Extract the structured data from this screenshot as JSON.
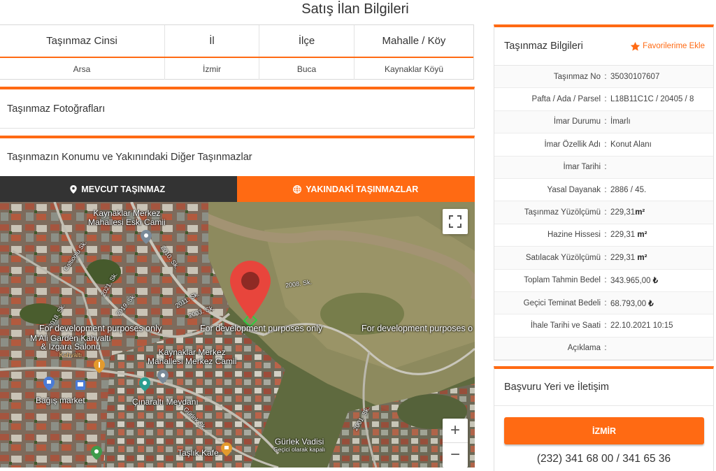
{
  "page_title": "Satış İlan Bilgileri",
  "summary": {
    "headers": [
      "Taşınmaz Cinsi",
      "İl",
      "İlçe",
      "Mahalle / Köy"
    ],
    "values": [
      "Arsa",
      "İzmir",
      "Buca",
      "Kaynaklar Köyü"
    ]
  },
  "photos_panel": {
    "title": "Taşınmaz Fotoğrafları"
  },
  "location_panel": {
    "title": "Taşınmazın Konumu ve Yakınındaki Diğer Taşınmazlar",
    "tab_current": "MEVCUT TAŞINMAZ",
    "tab_nearby": "YAKINDAKİ TAŞINMAZLAR"
  },
  "map": {
    "dev_notice": "For development purposes only",
    "dev_notice_truncated": "For development purposes o",
    "places": {
      "mosque_old": "Kaynaklar Merkez Mahallesi Eski Camii",
      "mosque_old_l1": "Kaynaklar Merkez",
      "mosque_old_l2": "Mahallesi Eski Camii",
      "garden": "M'Ali Garden Kahvaltı & Izgara Salonu",
      "garden_l1": "M'Ali Garden Kahvaltı",
      "garden_l2": "& Izgara Salonu",
      "garden_sub": "Kahvaltı",
      "mosque_center_l1": "Kaynaklar Merkez",
      "mosque_center_l2": "Mahallesi Merkez Camii",
      "market": "Bağış market",
      "square": "Çınaraltı Meydanı",
      "valley": "Gürlek Vadisi",
      "valley_sub": "Geçici olarak kapalı",
      "cafe": "Taşlık Kafe"
    },
    "streets": [
      "2008. Sk.",
      "2011. Sk.",
      "2003. Sk.",
      "2010. Sk.",
      "2019. Sk.",
      "2021. Sk.",
      "2018. Sk.",
      "2001. Sk.",
      "Gürlek Sk.",
      "Caltioglu Sk."
    ],
    "zoom_in": "+",
    "zoom_out": "−"
  },
  "info": {
    "title": "Taşınmaz Bilgileri",
    "favorite_label": "Favorilerime Ekle",
    "rows": [
      {
        "label": "Taşınmaz No",
        "value": "35030107607",
        "unit": ""
      },
      {
        "label": "Pafta / Ada / Parsel",
        "value": "L18B11C1C / 20405 / 8",
        "unit": ""
      },
      {
        "label": "İmar Durumu",
        "value": "İmarlı",
        "unit": ""
      },
      {
        "label": "İmar Özellik Adı",
        "value": "Konut Alanı",
        "unit": ""
      },
      {
        "label": "İmar Tarihi",
        "value": "",
        "unit": ""
      },
      {
        "label": "Yasal Dayanak",
        "value": "2886 / 45.",
        "unit": ""
      },
      {
        "label": "Taşınmaz Yüzölçümü",
        "value": "229,31",
        "unit": "m²"
      },
      {
        "label": "Hazine Hissesi",
        "value": "229,31 ",
        "unit": "m²"
      },
      {
        "label": "Satılacak Yüzölçümü",
        "value": "229,31 ",
        "unit": "m²"
      },
      {
        "label": "Toplam Tahmin Bedel",
        "value": "343.965,00 ",
        "unit": "₺"
      },
      {
        "label": "Geçici Teminat Bedeli",
        "value": "68.793,00 ",
        "unit": "₺"
      },
      {
        "label": "İhale Tarihi ve Saati",
        "value": "22.10.2021 10:15",
        "unit": ""
      },
      {
        "label": "Açıklama",
        "value": "",
        "unit": ""
      }
    ]
  },
  "contact": {
    "title": "Başvuru Yeri ve İletişim",
    "city_button": "İZMİR",
    "phone": "(232) 341 68 00 / 341 65 36"
  },
  "colors": {
    "accent": "#ff6a13",
    "tab_dark": "#333333",
    "pin": "#e8453c"
  }
}
